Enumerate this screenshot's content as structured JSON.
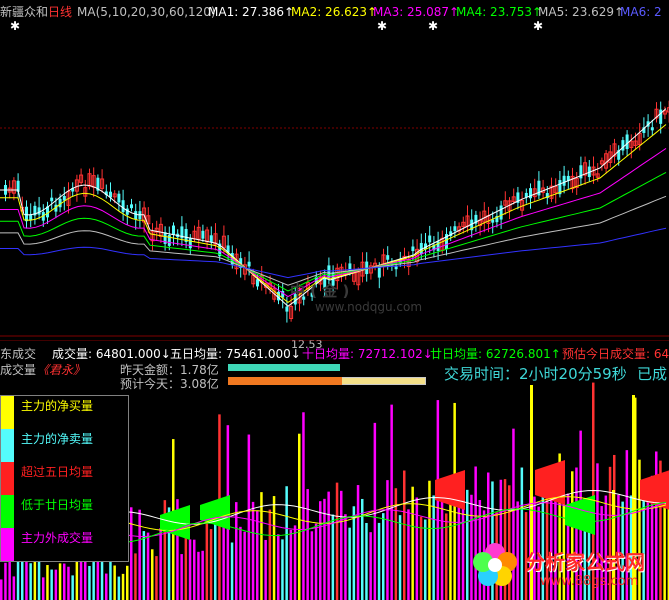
{
  "colors": {
    "bg": "#000000",
    "up": "#ff3232",
    "down": "#54fcfc",
    "white": "#ffffff",
    "yellow": "#ffff00",
    "magenta": "#ff00ff",
    "green": "#00ff00",
    "grid": "#7f0000"
  },
  "price_panel": {
    "stock_name": "新疆众和",
    "period": "日线",
    "ma_params": "MA(5,10,20,30,60,120)",
    "ma1": "MA1: 27.386↑",
    "ma2": "MA2: 26.623↑",
    "ma3": "MA3: 25.087↑",
    "ma4": "MA4: 23.753↑",
    "ma5": "MA5: 23.629↑",
    "ma6": "MA6: 2",
    "low_label": "12.53",
    "watermark_cn": "中 ( 金 ) ",
    "watermark_url": "www.nodqgu.com"
  },
  "volume_panel": {
    "hdr_left": "东成交",
    "vol": "成交量: 64801.000↓",
    "ma5_vol": "五日均量: 75461.000↓",
    "ma10_vol": "十日均量: 72712.102↓",
    "ma20_vol": "廿日均量: 62726.801↑",
    "forecast": "预估今日成交量: 64",
    "indicator_name": "成交量",
    "indicator_alias": "《君永》",
    "yesterday_amount": "昨天金额：1.78亿",
    "today_forecast": "预计今天：3.08亿",
    "trade_time": "交易时间：2小时20分59秒",
    "trade_status": "已成",
    "legend": [
      {
        "label": "主力的净买量",
        "color": "#ffff00",
        "text_color": "#ffff00"
      },
      {
        "label": "主力的净卖量",
        "color": "#54fcfc",
        "text_color": "#54fcfc"
      },
      {
        "label": "超过五日均量",
        "color": "#ff2020",
        "text_color": "#ff2020"
      },
      {
        "label": "低于廿日均量",
        "color": "#00ff00",
        "text_color": "#00ff00"
      },
      {
        "label": "主力外成交量",
        "color": "#ff00ff",
        "text_color": "#ff00ff"
      }
    ]
  },
  "branding": {
    "logo_cn": "分析家公式网",
    "logo_url": "www.88gs.com"
  }
}
